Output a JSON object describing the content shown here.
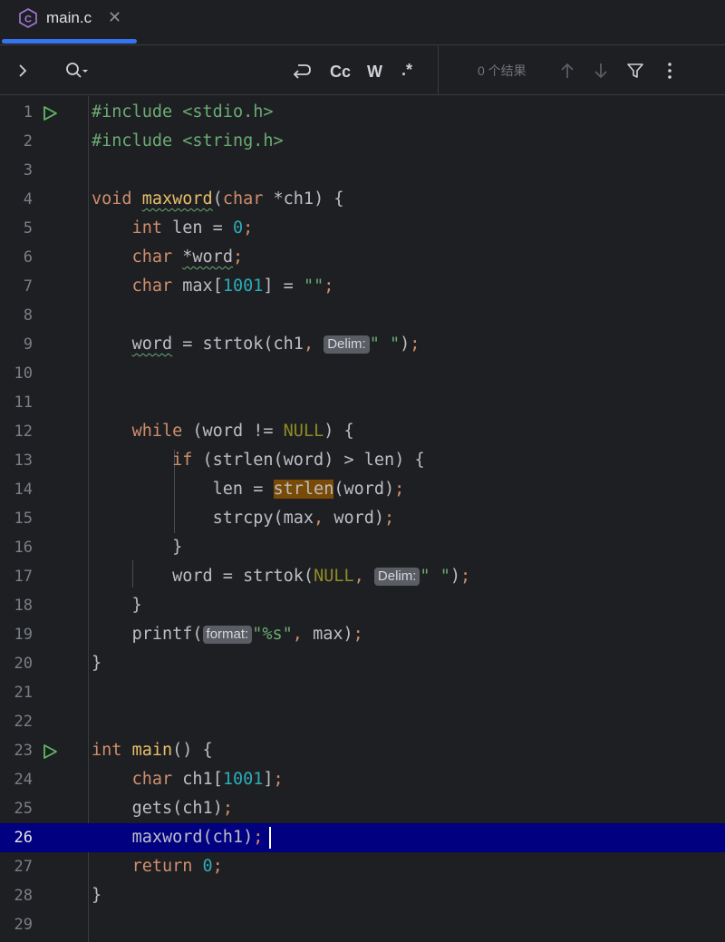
{
  "tab": {
    "file_name": "main.c",
    "icon": "c-file-icon",
    "close_symbol": "✕",
    "accent": "#3574f0"
  },
  "search": {
    "expand_symbol": "›",
    "regex_label": ".*",
    "case_label": "Cc",
    "word_label": "W",
    "results_text": "0 个结果"
  },
  "editor": {
    "current_line": 26,
    "hints": {
      "delim": "Delim:",
      "format": "format:"
    },
    "lines": [
      "#include <stdio.h>",
      "#include <string.h>",
      "",
      "void maxword(char *ch1) {",
      "    int len = 0;",
      "    char *word;",
      "    char max[1001] = \"\";",
      "",
      "    word = strtok(ch1, \" \");",
      "",
      "",
      "    while (word != NULL) {",
      "        if (strlen(word) > len) {",
      "            len = strlen(word);",
      "            strcpy(max, word);",
      "        }",
      "        word = strtok(NULL, \" \");",
      "    }",
      "    printf(\"%s\", max);",
      "}",
      "",
      "",
      "int main() {",
      "    char ch1[1001];",
      "    gets(ch1);",
      "    maxword(ch1);",
      "    return 0;",
      "}",
      ""
    ],
    "tokens": {
      "include": "#include",
      "stdio": "<stdio.h>",
      "string": "<string.h>",
      "void": "void",
      "maxword": "maxword",
      "char": "char",
      "ch1_param": "*ch1",
      "int": "int",
      "len": "len",
      "zero": "0",
      "word_ptr": "*word",
      "max": "max",
      "n1001": "1001",
      "empty_str": "\"\"",
      "word": "word",
      "strtok": "strtok",
      "ch1": "ch1",
      "space_str": "\" \"",
      "while": "while",
      "null": "NULL",
      "if": "if",
      "strlen": "strlen",
      "strcpy": "strcpy",
      "printf": "printf",
      "fmt_str": "\"%s\"",
      "main": "main",
      "gets": "gets",
      "return": "return"
    }
  }
}
